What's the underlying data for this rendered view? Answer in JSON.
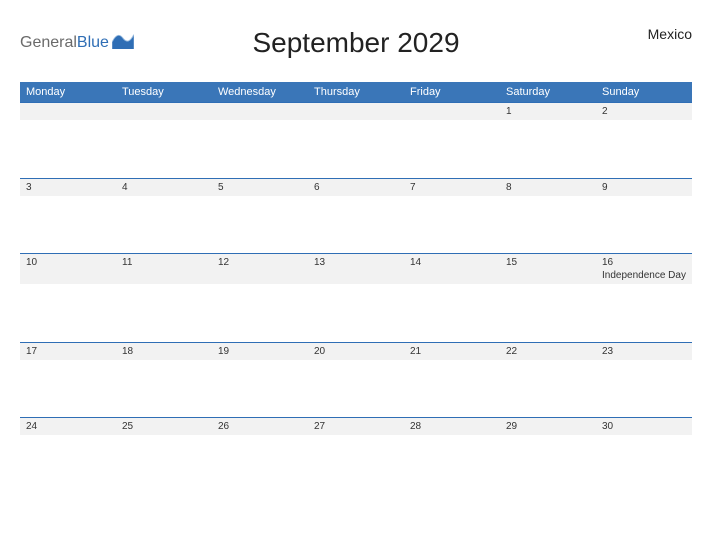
{
  "brand": {
    "part1": "General",
    "part2": "Blue"
  },
  "title": "September 2029",
  "country": "Mexico",
  "days": [
    "Monday",
    "Tuesday",
    "Wednesday",
    "Thursday",
    "Friday",
    "Saturday",
    "Sunday"
  ],
  "weeks": [
    [
      {
        "n": ""
      },
      {
        "n": ""
      },
      {
        "n": ""
      },
      {
        "n": ""
      },
      {
        "n": ""
      },
      {
        "n": "1"
      },
      {
        "n": "2"
      }
    ],
    [
      {
        "n": "3"
      },
      {
        "n": "4"
      },
      {
        "n": "5"
      },
      {
        "n": "6"
      },
      {
        "n": "7"
      },
      {
        "n": "8"
      },
      {
        "n": "9"
      }
    ],
    [
      {
        "n": "10"
      },
      {
        "n": "11"
      },
      {
        "n": "12"
      },
      {
        "n": "13"
      },
      {
        "n": "14"
      },
      {
        "n": "15"
      },
      {
        "n": "16",
        "event": "Independence Day"
      }
    ],
    [
      {
        "n": "17"
      },
      {
        "n": "18"
      },
      {
        "n": "19"
      },
      {
        "n": "20"
      },
      {
        "n": "21"
      },
      {
        "n": "22"
      },
      {
        "n": "23"
      }
    ],
    [
      {
        "n": "24"
      },
      {
        "n": "25"
      },
      {
        "n": "26"
      },
      {
        "n": "27"
      },
      {
        "n": "28"
      },
      {
        "n": "29"
      },
      {
        "n": "30"
      }
    ]
  ]
}
